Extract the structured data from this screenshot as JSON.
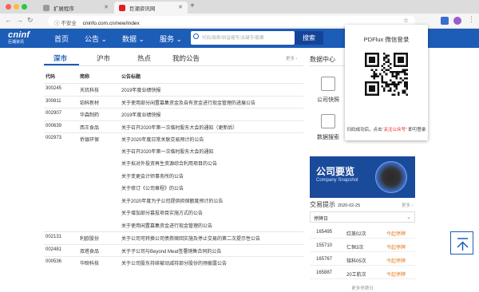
{
  "browser": {
    "tabs": [
      {
        "label": "扩展程序",
        "active": false
      },
      {
        "label": "巨潮资讯网",
        "active": true
      }
    ],
    "security_label": "不安全",
    "url": "cninfo.com.cn/new/index",
    "extensions": [
      "pdflux-extension-icon",
      "profile-icon",
      "menu-icon"
    ]
  },
  "site": {
    "logo_en": "cninf",
    "logo_cn": "巨潮资讯",
    "nav": [
      "首页",
      "公告",
      "数据",
      "服务"
    ],
    "search_placeholder": "代码/简称/拼音缩写/关键字/股票",
    "search_button": "搜索",
    "accent_color": "#1c5db8"
  },
  "subtabs": [
    "深市",
    "沪市",
    "热点",
    "我的公告"
  ],
  "more_label": "更多",
  "table": {
    "headers": [
      "代码",
      "简称",
      "公告标题"
    ],
    "rows": [
      {
        "code": "300245",
        "name": "天玑科技",
        "title": "2019年度业绩快报"
      },
      {
        "code": "300811",
        "name": "铂科新材",
        "title": "关于使用部分闲置募集资金及自有资金进行现金管理的进展公告"
      },
      {
        "code": "002907",
        "name": "华森制药",
        "title": "2019年度业绩快报"
      },
      {
        "code": "000639",
        "name": "西王食品",
        "title": "关于召开2020年第一次临时股东大会的通知（更新后）"
      },
      {
        "code": "002973",
        "name": "侨银环保",
        "title": "关于2020年度日常关联交易预计的公告"
      },
      {
        "code": "",
        "name": "",
        "title": "关于召开2020年第一次临时股东大会的通知"
      },
      {
        "code": "",
        "name": "",
        "title": "关于拟对外投资再生资源综合利用项目的公告"
      },
      {
        "code": "",
        "name": "",
        "title": "关于变更会计师事务所的公告"
      },
      {
        "code": "",
        "name": "",
        "title": "关于修订《公司章程》的公告"
      },
      {
        "code": "",
        "name": "",
        "title": "关于2020年度为子公司提供担保额度预计的公告"
      },
      {
        "code": "",
        "name": "",
        "title": "关于增加部分募投项目实施方式的公告"
      },
      {
        "code": "",
        "name": "",
        "title": "关于使用闲置募集资金进行现金管理的公告"
      },
      {
        "code": "002131",
        "name": "利欧股份",
        "title": "关于公司可转换公司债券赎回实施及停止交易的第二次提示性公告"
      },
      {
        "code": "002481",
        "name": "双塔食品",
        "title": "关于子公司与Beyond Meat签署销售合同的公告"
      },
      {
        "code": "000536",
        "name": "华映科技",
        "title": "关于公司股东持续被动减持部分股份的预披露公告"
      }
    ]
  },
  "data_center": {
    "title_part1": "数据",
    "title_part2": "中心",
    "items": [
      "公司快照",
      "数据搜索"
    ]
  },
  "banner": {
    "title": "公司要览",
    "subtitle": "Company Snapshot"
  },
  "trading": {
    "title_part1": "交易",
    "title_part2": "提示",
    "date": "2020-02-25",
    "more": "更多",
    "select_value": "停牌日",
    "rows": [
      {
        "code": "165495",
        "name": "红美02次",
        "status": "今起停牌"
      },
      {
        "code": "155710",
        "name": "仁恒3次",
        "status": "今起停牌"
      },
      {
        "code": "165767",
        "name": "铭科05次",
        "status": "今起停牌"
      },
      {
        "code": "165887",
        "name": "20工航次",
        "status": "今起停牌"
      }
    ],
    "footer": "更多停牌日"
  },
  "popup": {
    "title": "PDFlux 微信登录",
    "message_before": "扫码成功后，点击",
    "message_highlight": "“关注公众号”",
    "message_after": "即可登录"
  }
}
